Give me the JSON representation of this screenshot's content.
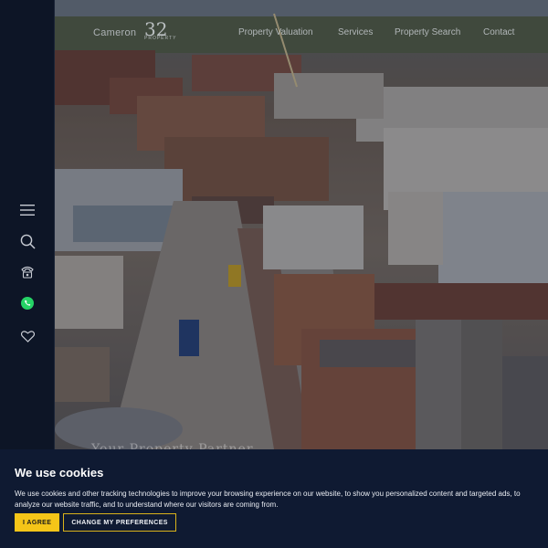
{
  "brand": {
    "name": "Cameron",
    "number": "32",
    "number_sub": "PROPERTY"
  },
  "nav": {
    "items": [
      "Property Valuation",
      "Services",
      "Property Search",
      "Contact"
    ]
  },
  "rail": {
    "icons": [
      "menu-icon",
      "search-icon",
      "phone-icon",
      "whatsapp-icon",
      "heart-icon"
    ]
  },
  "hero": {
    "caption": "Your Property Partner"
  },
  "cookie": {
    "title": "We use cookies",
    "body": "We use cookies and other tracking technologies to improve your browsing experience on our website, to show you personalized content and targeted ads, to analyze our website traffic, and to understand where our visitors are coming from.",
    "agree_label": "I AGREE",
    "prefs_label": "CHANGE MY PREFERENCES"
  },
  "colors": {
    "accent": "#f5c518",
    "banner": "#0f1a32",
    "rail": "#0d1526",
    "whatsapp": "#25d366"
  }
}
